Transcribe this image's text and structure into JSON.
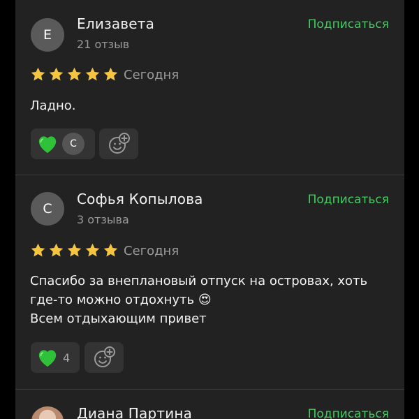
{
  "reviews": [
    {
      "avatar_letter": "Е",
      "author": "Елизавета",
      "review_count": "21 отзыв",
      "subscribe_label": "Подписаться",
      "rating": 5,
      "date": "Сегодня",
      "text_lines": [
        "Ладно."
      ],
      "reaction": {
        "emoji": "green-heart",
        "reactor_letter": "С"
      }
    },
    {
      "avatar_letter": "С",
      "author": "Софья Копылова",
      "review_count": "3 отзыва",
      "subscribe_label": "Подписаться",
      "rating": 5,
      "date": "Сегодня",
      "text_lines": [
        "Спасибо за внеплановый отпуск на островах, хоть",
        "где-то можно отдохнуть 😍",
        "Всем отдыхающим привет"
      ],
      "reaction": {
        "emoji": "green-heart",
        "count": "4"
      }
    },
    {
      "author": "Диана Партина",
      "subscribe_label": "Подписаться"
    }
  ],
  "colors": {
    "background": "#000000",
    "panel": "#222222",
    "accent_green": "#3fcf5e",
    "star_yellow": "#f5c542",
    "secondary_text": "#9a9a9a"
  }
}
